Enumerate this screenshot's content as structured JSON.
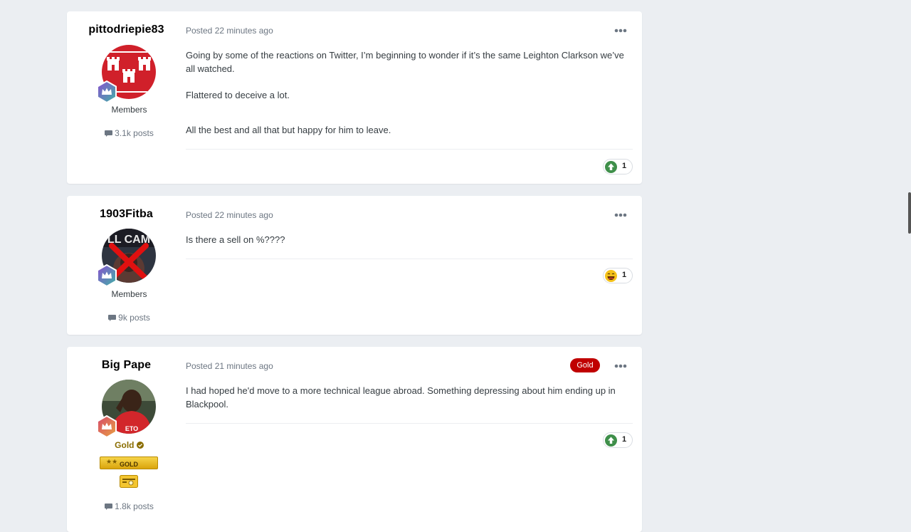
{
  "posts": [
    {
      "author": "pittodriepie83",
      "group": "Members",
      "post_count": "3.1k posts",
      "posted_prefix": "Posted",
      "posted_time": "22 minutes ago",
      "paragraphs": [
        "Going by some of the reactions on Twitter, I’m beginning to wonder if it’s the same Leighton Clarkson we’ve all watched.",
        "Flattered to deceive a lot.",
        "All the best and all that but happy for him to leave."
      ],
      "reaction_icon": "upvote-icon",
      "reaction_count": "1"
    },
    {
      "author": "1903Fitba",
      "group": "Members",
      "post_count": "9k posts",
      "posted_prefix": "Posted",
      "posted_time": "22 minutes ago",
      "paragraphs": [
        "Is there a sell on %????"
      ],
      "reaction_icon": "laughing-face-icon",
      "reaction_count": "1"
    },
    {
      "author": "Big Pape",
      "group": "Gold",
      "post_count": "1.8k posts",
      "posted_prefix": "Posted",
      "posted_time": "21 minutes ago",
      "badge": "Gold",
      "award_label": "GOLD",
      "paragraphs": [
        "I had hoped he'd move to a more technical league abroad. Something depressing about him ending up in Blackpool."
      ],
      "reaction_icon": "upvote-icon",
      "reaction_count": "1"
    }
  ],
  "colors": {
    "background": "#ebeef2",
    "card": "#ffffff",
    "gold_badge": "#c00000",
    "upvote": "#3f8f4a",
    "meta_text": "#6c7682"
  }
}
